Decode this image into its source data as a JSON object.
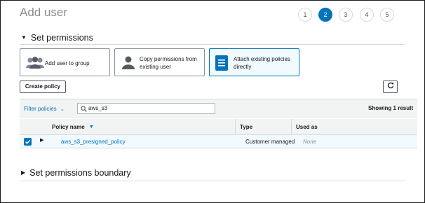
{
  "page": {
    "title": "Add user"
  },
  "steps": [
    {
      "label": "1",
      "active": false
    },
    {
      "label": "2",
      "active": true
    },
    {
      "label": "3",
      "active": false
    },
    {
      "label": "4",
      "active": false
    },
    {
      "label": "5",
      "active": false
    }
  ],
  "sections": {
    "permissions": "Set permissions",
    "boundary": "Set permissions boundary"
  },
  "options": [
    {
      "label": "Add user to group",
      "icon": "user-group-icon",
      "selected": false
    },
    {
      "label": "Copy permissions from existing user",
      "icon": "user-icon",
      "selected": false
    },
    {
      "label": "Attach existing policies directly",
      "icon": "policy-document-icon",
      "selected": true
    }
  ],
  "toolbar": {
    "create_policy": "Create policy",
    "refresh_icon": "refresh-icon"
  },
  "filter": {
    "label": "Filter policies",
    "search_value": "aws_s3",
    "showing": "Showing 1 result"
  },
  "table": {
    "columns": [
      "Policy name",
      "Type",
      "Used as"
    ],
    "rows": [
      {
        "checked": true,
        "name": "aws_s3_presigned_policy",
        "type": "Customer managed",
        "used_as": "None"
      }
    ]
  },
  "colors": {
    "accent": "#0073bb",
    "selected_bg": "#f1faff",
    "header_bg": "#f2f3f3"
  }
}
